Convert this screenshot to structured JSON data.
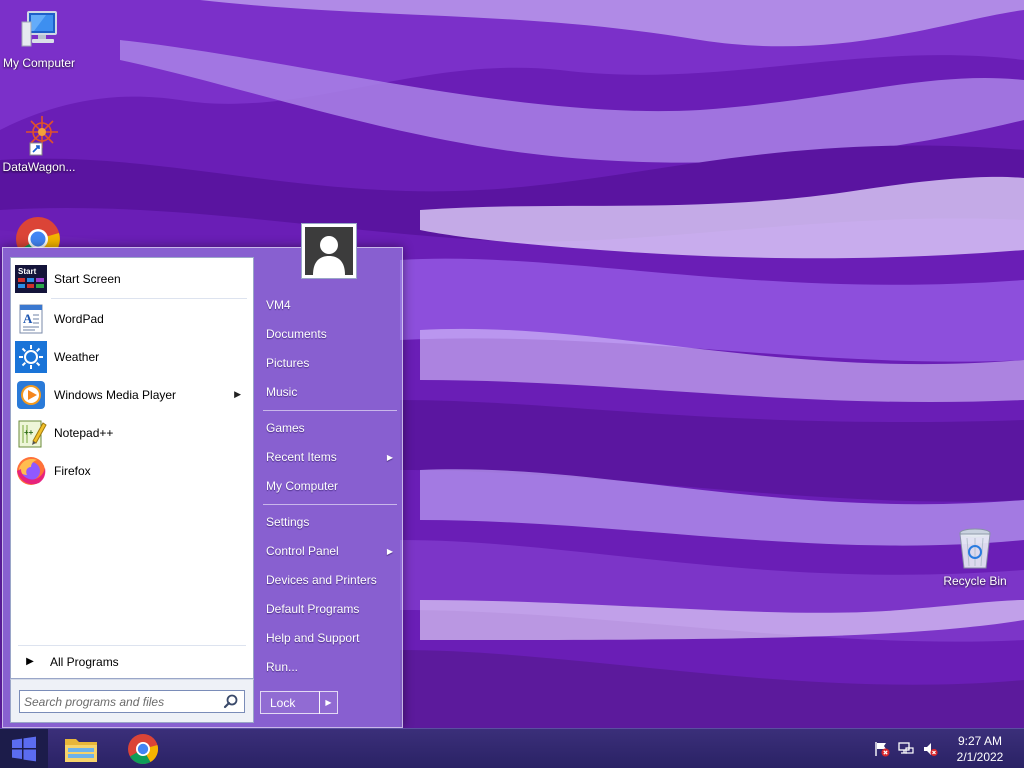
{
  "desktop": {
    "icons": [
      {
        "label": "My Computer",
        "icon": "monitor-icon"
      },
      {
        "label": "DataWagon...",
        "icon": "datawagon-icon"
      },
      {
        "label": "Recycle Bin",
        "icon": "recycle-bin-icon"
      }
    ]
  },
  "start_menu": {
    "pinned": [
      {
        "label": "Start Screen",
        "icon": "start-screen-icon"
      },
      {
        "label": "WordPad",
        "icon": "wordpad-icon"
      },
      {
        "label": "Weather",
        "icon": "weather-icon"
      },
      {
        "label": "Windows Media Player",
        "icon": "media-player-icon",
        "has_submenu": true
      },
      {
        "label": "Notepad++",
        "icon": "notepadpp-icon"
      },
      {
        "label": "Firefox",
        "icon": "firefox-icon"
      }
    ],
    "all_programs": "All Programs",
    "search_placeholder": "Search programs and files",
    "right_links": [
      {
        "label": "VM4"
      },
      {
        "label": "Documents"
      },
      {
        "label": "Pictures"
      },
      {
        "label": "Music"
      },
      {
        "label": "Games"
      },
      {
        "label": "Recent Items",
        "has_submenu": true
      },
      {
        "label": "My Computer"
      },
      {
        "label": "Settings"
      },
      {
        "label": "Control Panel",
        "has_submenu": true
      },
      {
        "label": "Devices and Printers"
      },
      {
        "label": "Default Programs"
      },
      {
        "label": "Help and Support"
      },
      {
        "label": "Run..."
      }
    ],
    "lock_label": "Lock"
  },
  "taskbar": {
    "apps": [
      {
        "icon": "file-explorer-icon"
      },
      {
        "icon": "chrome-icon"
      }
    ],
    "tray_icons": [
      "action-center-flag-icon",
      "network-icon",
      "volume-muted-icon"
    ],
    "time": "9:27 AM",
    "date": "2/1/2022"
  },
  "colors": {
    "wallpaper": "#6b1fb8",
    "taskbar": "#2e2668",
    "start_menu_glass": "#a096e6"
  }
}
